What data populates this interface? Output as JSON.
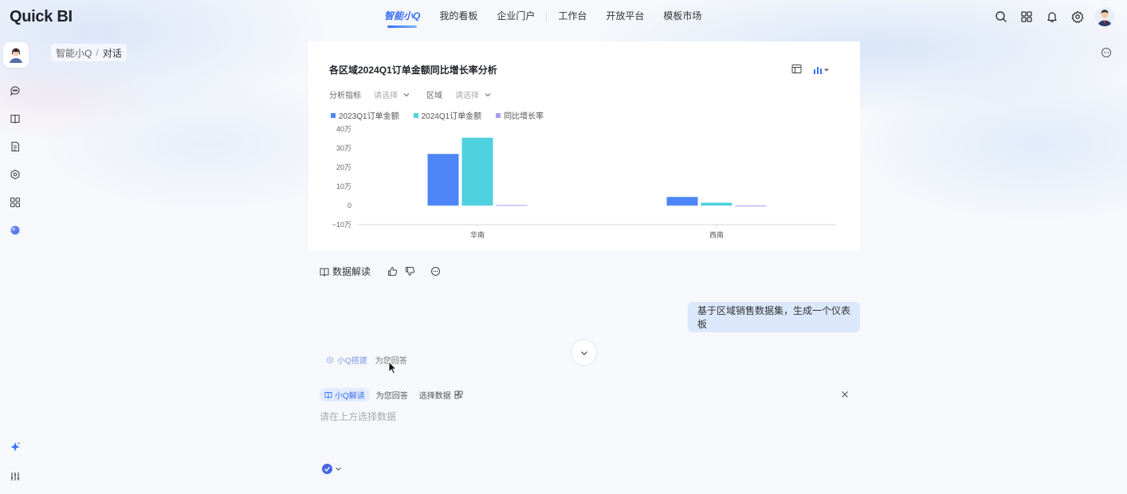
{
  "app": {
    "logo": "Quick BI"
  },
  "nav": {
    "items": [
      {
        "label": "智能小Q",
        "active": true
      },
      {
        "label": "我的看板"
      },
      {
        "label": "企业门户"
      },
      {
        "label": "工作台"
      },
      {
        "label": "开放平台"
      },
      {
        "label": "模板市场"
      }
    ]
  },
  "top_icons": [
    "search-icon",
    "apps-grid-icon",
    "bell-icon",
    "gear-icon",
    "user-avatar"
  ],
  "rail_icons": [
    "agent-avatar",
    "chat-icon",
    "book-icon",
    "report-icon",
    "ai-settings-icon",
    "apps-icon",
    "orb-icon",
    "sparkle-icon",
    "sliders-icon"
  ],
  "breadcrumb": {
    "root": "智能小Q",
    "separator": "/",
    "current": "对话"
  },
  "card": {
    "title": "各区域2024Q1订单金额同比增长率分析",
    "filters": [
      {
        "label": "分析指标",
        "placeholder": "请选择"
      },
      {
        "label": "区域",
        "placeholder": "请选择"
      }
    ]
  },
  "chart_data": {
    "type": "bar",
    "categories": [
      "华南",
      "西南"
    ],
    "series": [
      {
        "name": "2023Q1订单金额",
        "color": "#4e86f7",
        "values": [
          27,
          4.5
        ]
      },
      {
        "name": "2024Q1订单金额",
        "color": "#4fd1df",
        "values": [
          35.5,
          1.5
        ]
      },
      {
        "name": "同比增长率",
        "color": "#a79ef0",
        "values": [
          0.3,
          -0.3
        ]
      }
    ],
    "yticks": [
      "40万",
      "30万",
      "20万",
      "10万",
      "0",
      "−10万"
    ],
    "ylim": [
      -10,
      40
    ],
    "grid": false,
    "legend_position": "top-left"
  },
  "actions": {
    "interpret_label": "数据解读"
  },
  "user_message": "基于区域销售数据集，生成一个仪表板",
  "status": {
    "agent": "小Q搭建",
    "text": "为您回答"
  },
  "composer": {
    "agent_pill": "小Q解读",
    "agent_text": "为您回答",
    "select_data": "选择数据",
    "placeholder": "请在上方选择数据"
  }
}
